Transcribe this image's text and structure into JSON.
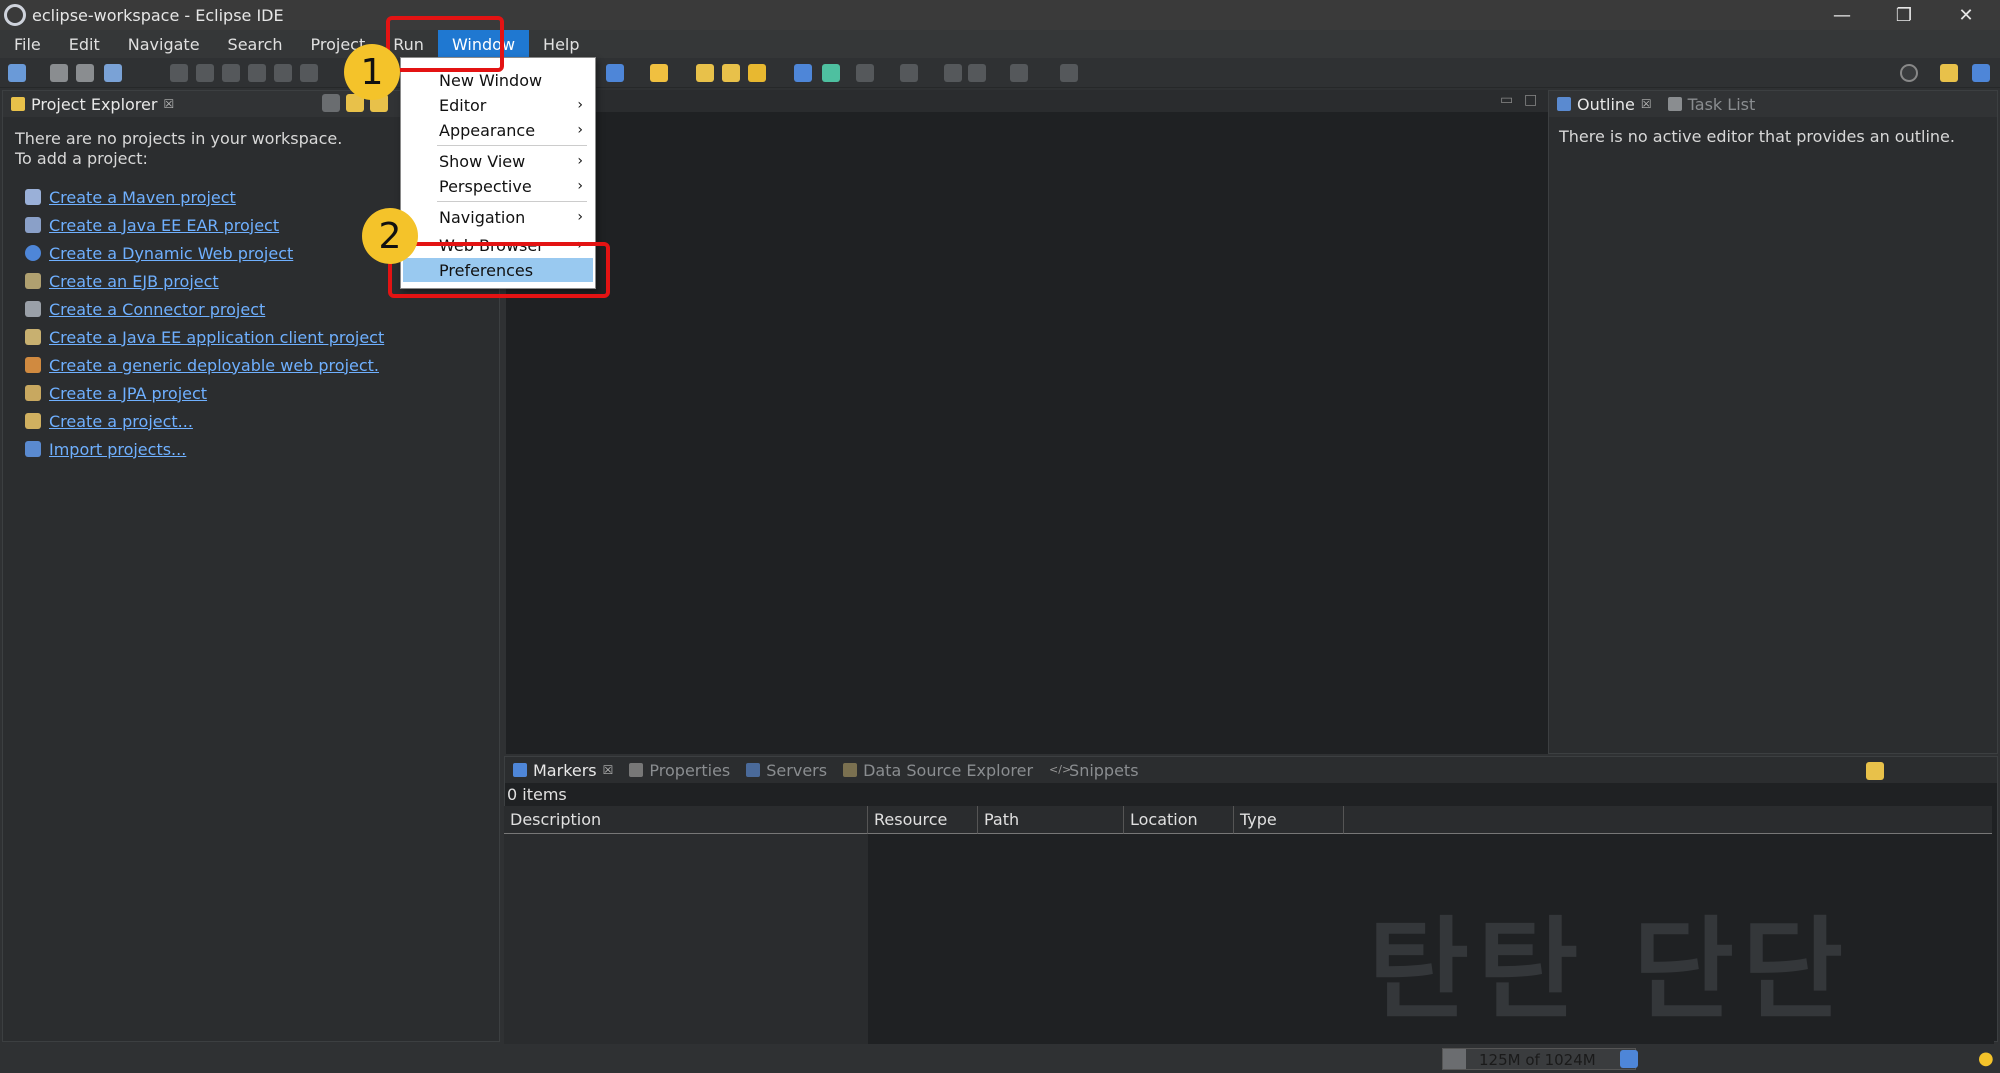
{
  "window": {
    "title": "eclipse-workspace - Eclipse IDE",
    "controls": {
      "minimize": "—",
      "restore": "❐",
      "close": "✕"
    }
  },
  "menubar": {
    "items": [
      "File",
      "Edit",
      "Navigate",
      "Search",
      "Project",
      "Run",
      "Window",
      "Help"
    ],
    "active": "Window"
  },
  "window_menu": {
    "items": [
      {
        "label": "New Window",
        "submenu": false
      },
      {
        "label": "Editor",
        "submenu": true
      },
      {
        "label": "Appearance",
        "submenu": true
      },
      {
        "label": "Show View",
        "submenu": true
      },
      {
        "label": "Perspective",
        "submenu": true
      },
      {
        "label": "Navigation",
        "submenu": true
      },
      {
        "label": "Web Browser",
        "submenu": true
      },
      {
        "label": "Preferences",
        "submenu": false,
        "selected": true
      }
    ],
    "submenu_arrow": "›"
  },
  "annotations": {
    "badge1": "1",
    "badge2": "2",
    "highlight_color": "#e31313",
    "badge_color": "#f4c32a"
  },
  "project_explorer": {
    "tab_label": "Project Explorer",
    "close": "☒",
    "message_line1": "There are no projects in your workspace.",
    "message_line2": "To add a project:",
    "links": [
      "Create a Maven project",
      "Create a Java EE EAR project",
      "Create a Dynamic Web project",
      "Create an EJB project",
      "Create a Connector project",
      "Create a Java EE application client project",
      "Create a generic deployable web project.",
      "Create a JPA project",
      "Create a project...",
      "Import projects..."
    ]
  },
  "outline": {
    "tabs": [
      "Outline",
      "Task List"
    ],
    "message": "There is no active editor that provides an outline."
  },
  "bottom_panel": {
    "tabs": [
      "Markers",
      "Properties",
      "Servers",
      "Data Source Explorer",
      "Snippets"
    ],
    "items_count": "0 items",
    "columns": [
      "Description",
      "Resource",
      "Path",
      "Location",
      "Type"
    ]
  },
  "watermark": "탄탄 단단",
  "status": {
    "heap": "125M of 1024M",
    "heap_fraction": 0.12
  }
}
